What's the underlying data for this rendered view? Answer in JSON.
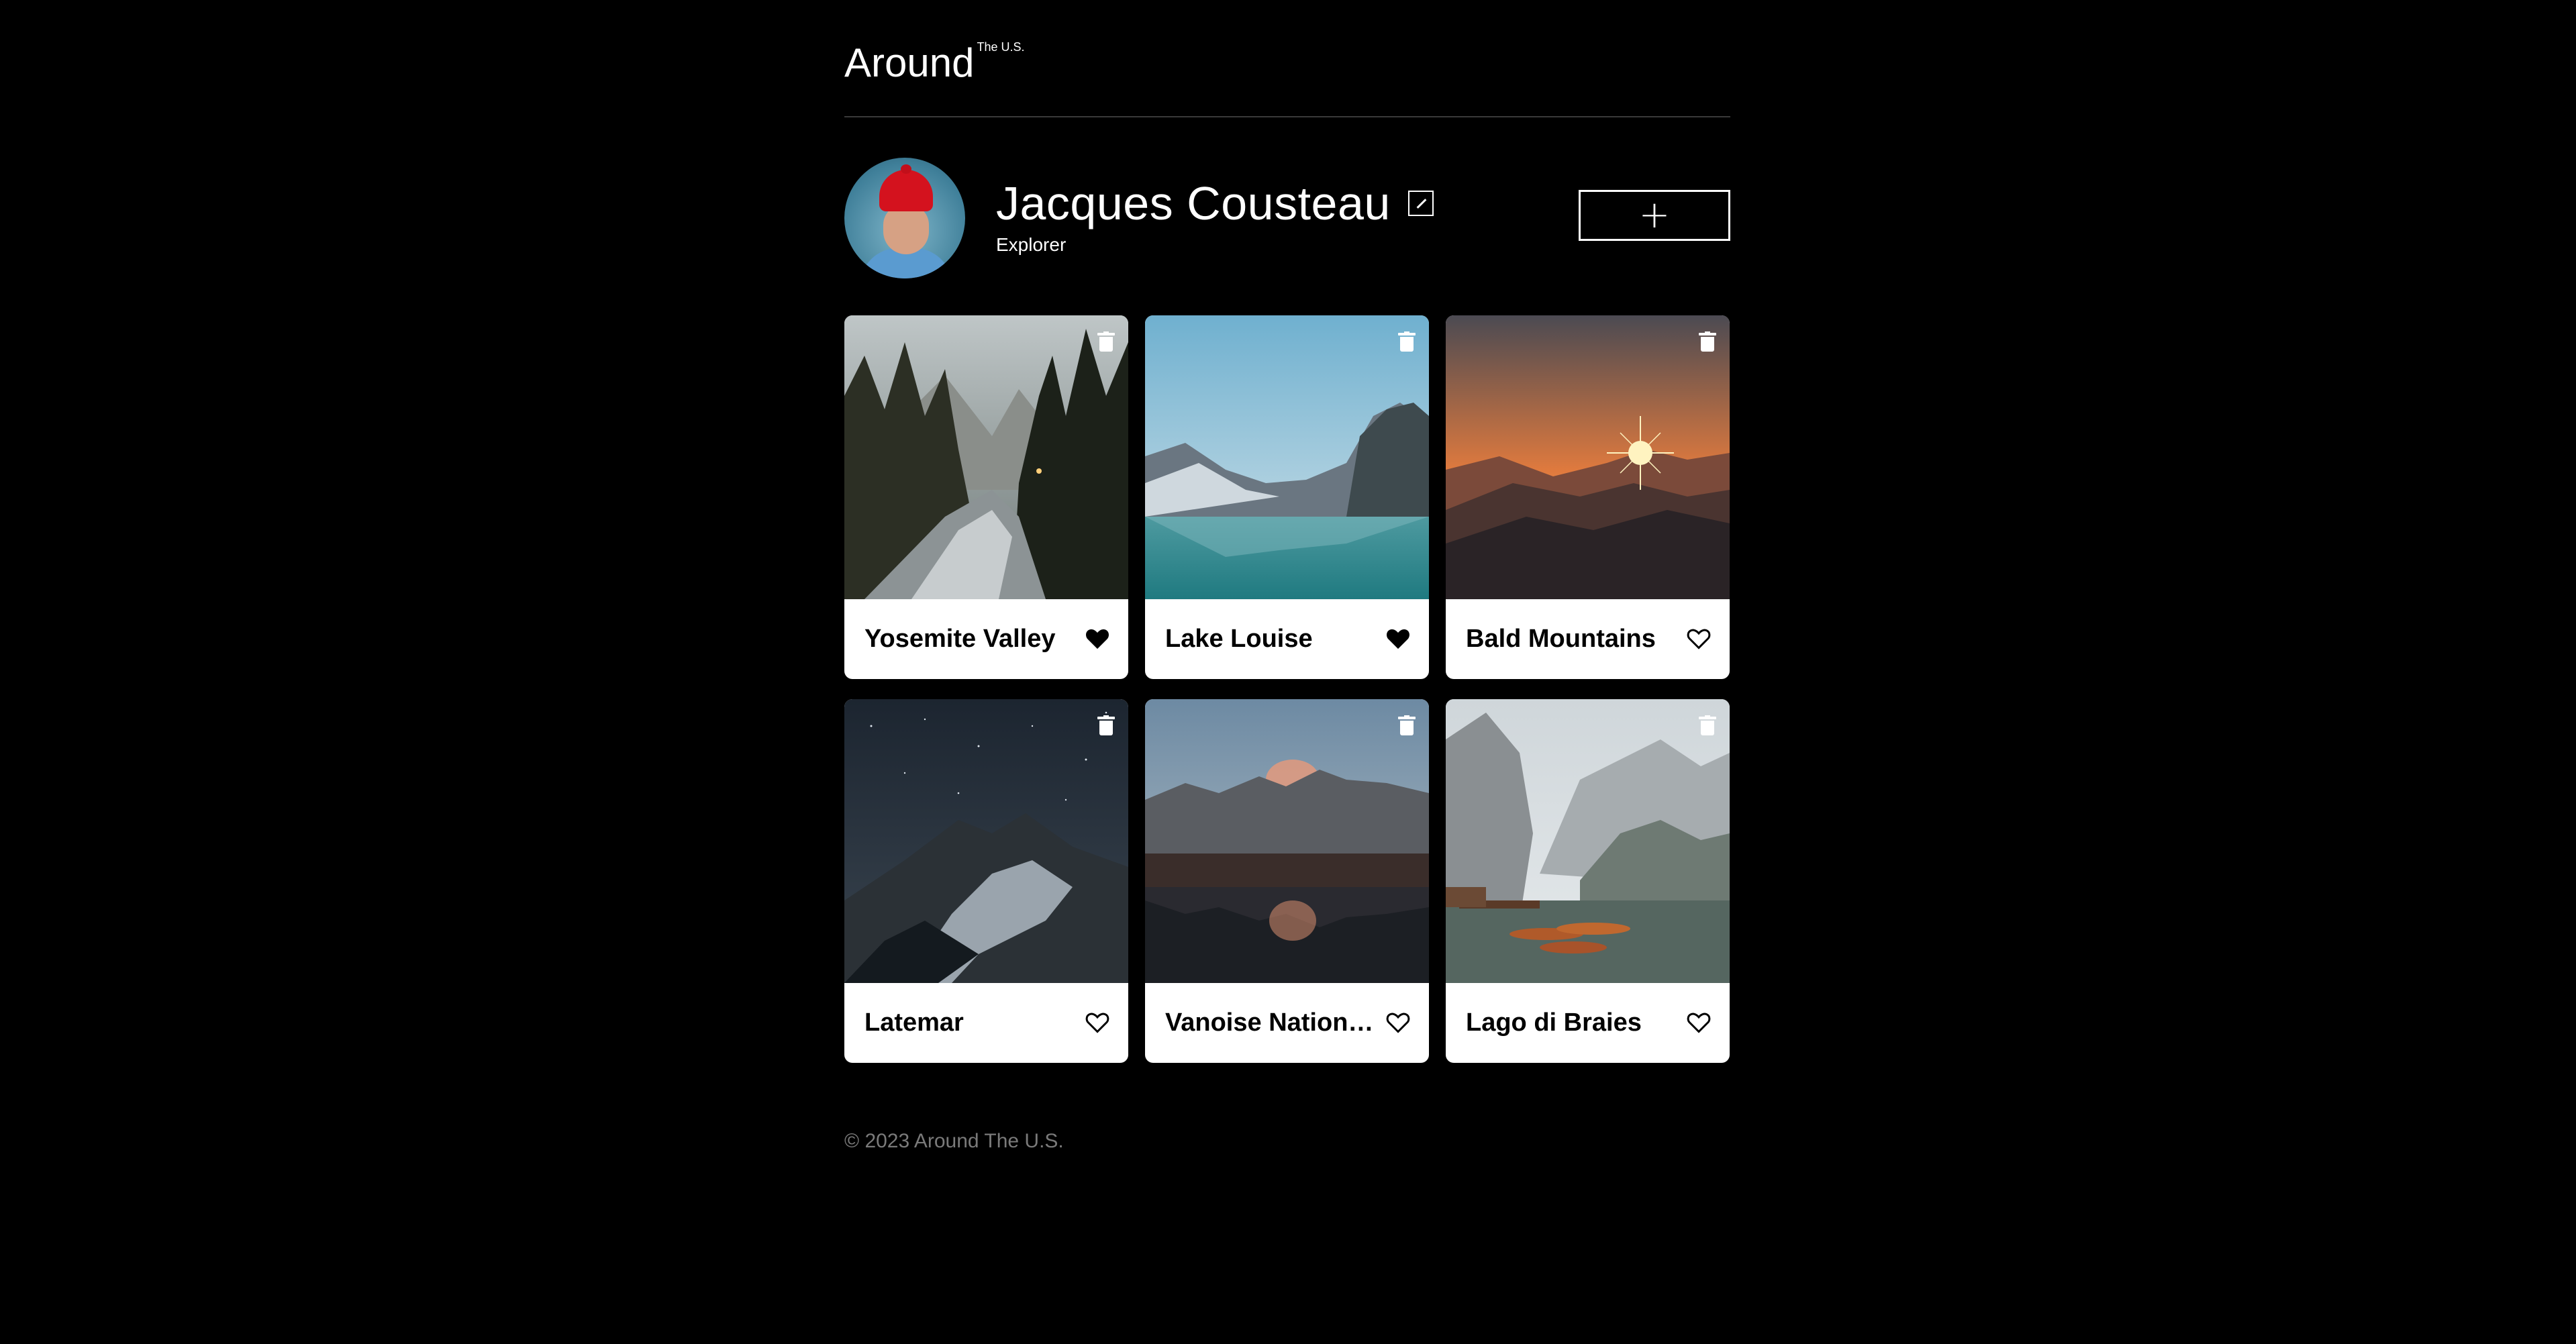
{
  "header": {
    "logo_main": "Around",
    "logo_sup": "The U.S."
  },
  "profile": {
    "name": "Jacques Cousteau",
    "job": "Explorer",
    "add_label": "+"
  },
  "cards": [
    {
      "title": "Yosemite Valley",
      "liked": true
    },
    {
      "title": "Lake Louise",
      "liked": true
    },
    {
      "title": "Bald Mountains",
      "liked": false
    },
    {
      "title": "Latemar",
      "liked": false
    },
    {
      "title": "Vanoise National Park",
      "liked": false
    },
    {
      "title": "Lago di Braies",
      "liked": false
    }
  ],
  "footer": {
    "copyright": "© 2023 Around The U.S."
  },
  "colors": {
    "background": "#000000",
    "card": "#ffffff",
    "text": "#ffffff",
    "footer_text": "#7a7a7a"
  },
  "icons": {
    "edit": "pencil-icon",
    "add": "plus-icon",
    "delete": "trash-icon",
    "like_active": "heart-filled-icon",
    "like_inactive": "heart-outline-icon"
  }
}
